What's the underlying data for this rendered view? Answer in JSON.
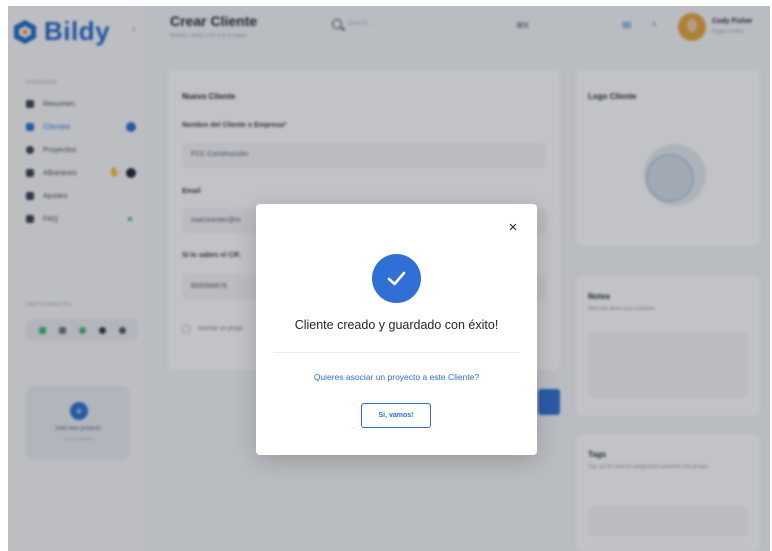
{
  "brand": {
    "name": "Bildy"
  },
  "header": {
    "title": "Crear Cliente",
    "subtitle": "Nombre, email y CIF si te lo sabes",
    "search_placeholder": "Search...",
    "shortcut": "⌘K",
    "user": {
      "name": "Cody Fisher",
      "role": "Digital Creator"
    }
  },
  "sidebar": {
    "section_overview": "OVERVIEW",
    "items": [
      {
        "label": "Resumen",
        "icon": "dashboard-icon"
      },
      {
        "label": "Clientes",
        "icon": "users-icon"
      },
      {
        "label": "Proyectos",
        "icon": "globe-icon"
      },
      {
        "label": "Albaranes",
        "icon": "bell-icon"
      },
      {
        "label": "Ajustes",
        "icon": "bookmark-icon"
      },
      {
        "label": "FAQ",
        "icon": "help-icon"
      }
    ],
    "section_team": "PARTICIPANTES",
    "add_card": {
      "title": "Add new product",
      "subtitle": "Or use invite link"
    }
  },
  "form": {
    "title": "Nuevo Cliente",
    "name_label": "Nombre del Cliente o Empresa*",
    "name_value": "FCC Construcción",
    "email_label": "Email",
    "email_value": "marcicenter@m",
    "cif_label": "Si te sabes el CIF,",
    "cif_value": "B55566678",
    "assoc_label": "Asociar un proye"
  },
  "logo_panel": {
    "title": "Logo Cliente"
  },
  "notes_panel": {
    "title": "Notes",
    "subtitle": "Add note about your customer"
  },
  "tags_panel": {
    "title": "Tags",
    "subtitle": "Tag can be used to categorized customers into groups"
  },
  "modal": {
    "title": "Cliente creado y guardado con éxito!",
    "question": "Quieres asociar un proyecto a este Cliente?",
    "button": "Si, vamos!",
    "close": "×"
  },
  "colors": {
    "accent": "#2c6fd1",
    "brand": "#1d66c8",
    "success_check": "#2f6fd6"
  }
}
